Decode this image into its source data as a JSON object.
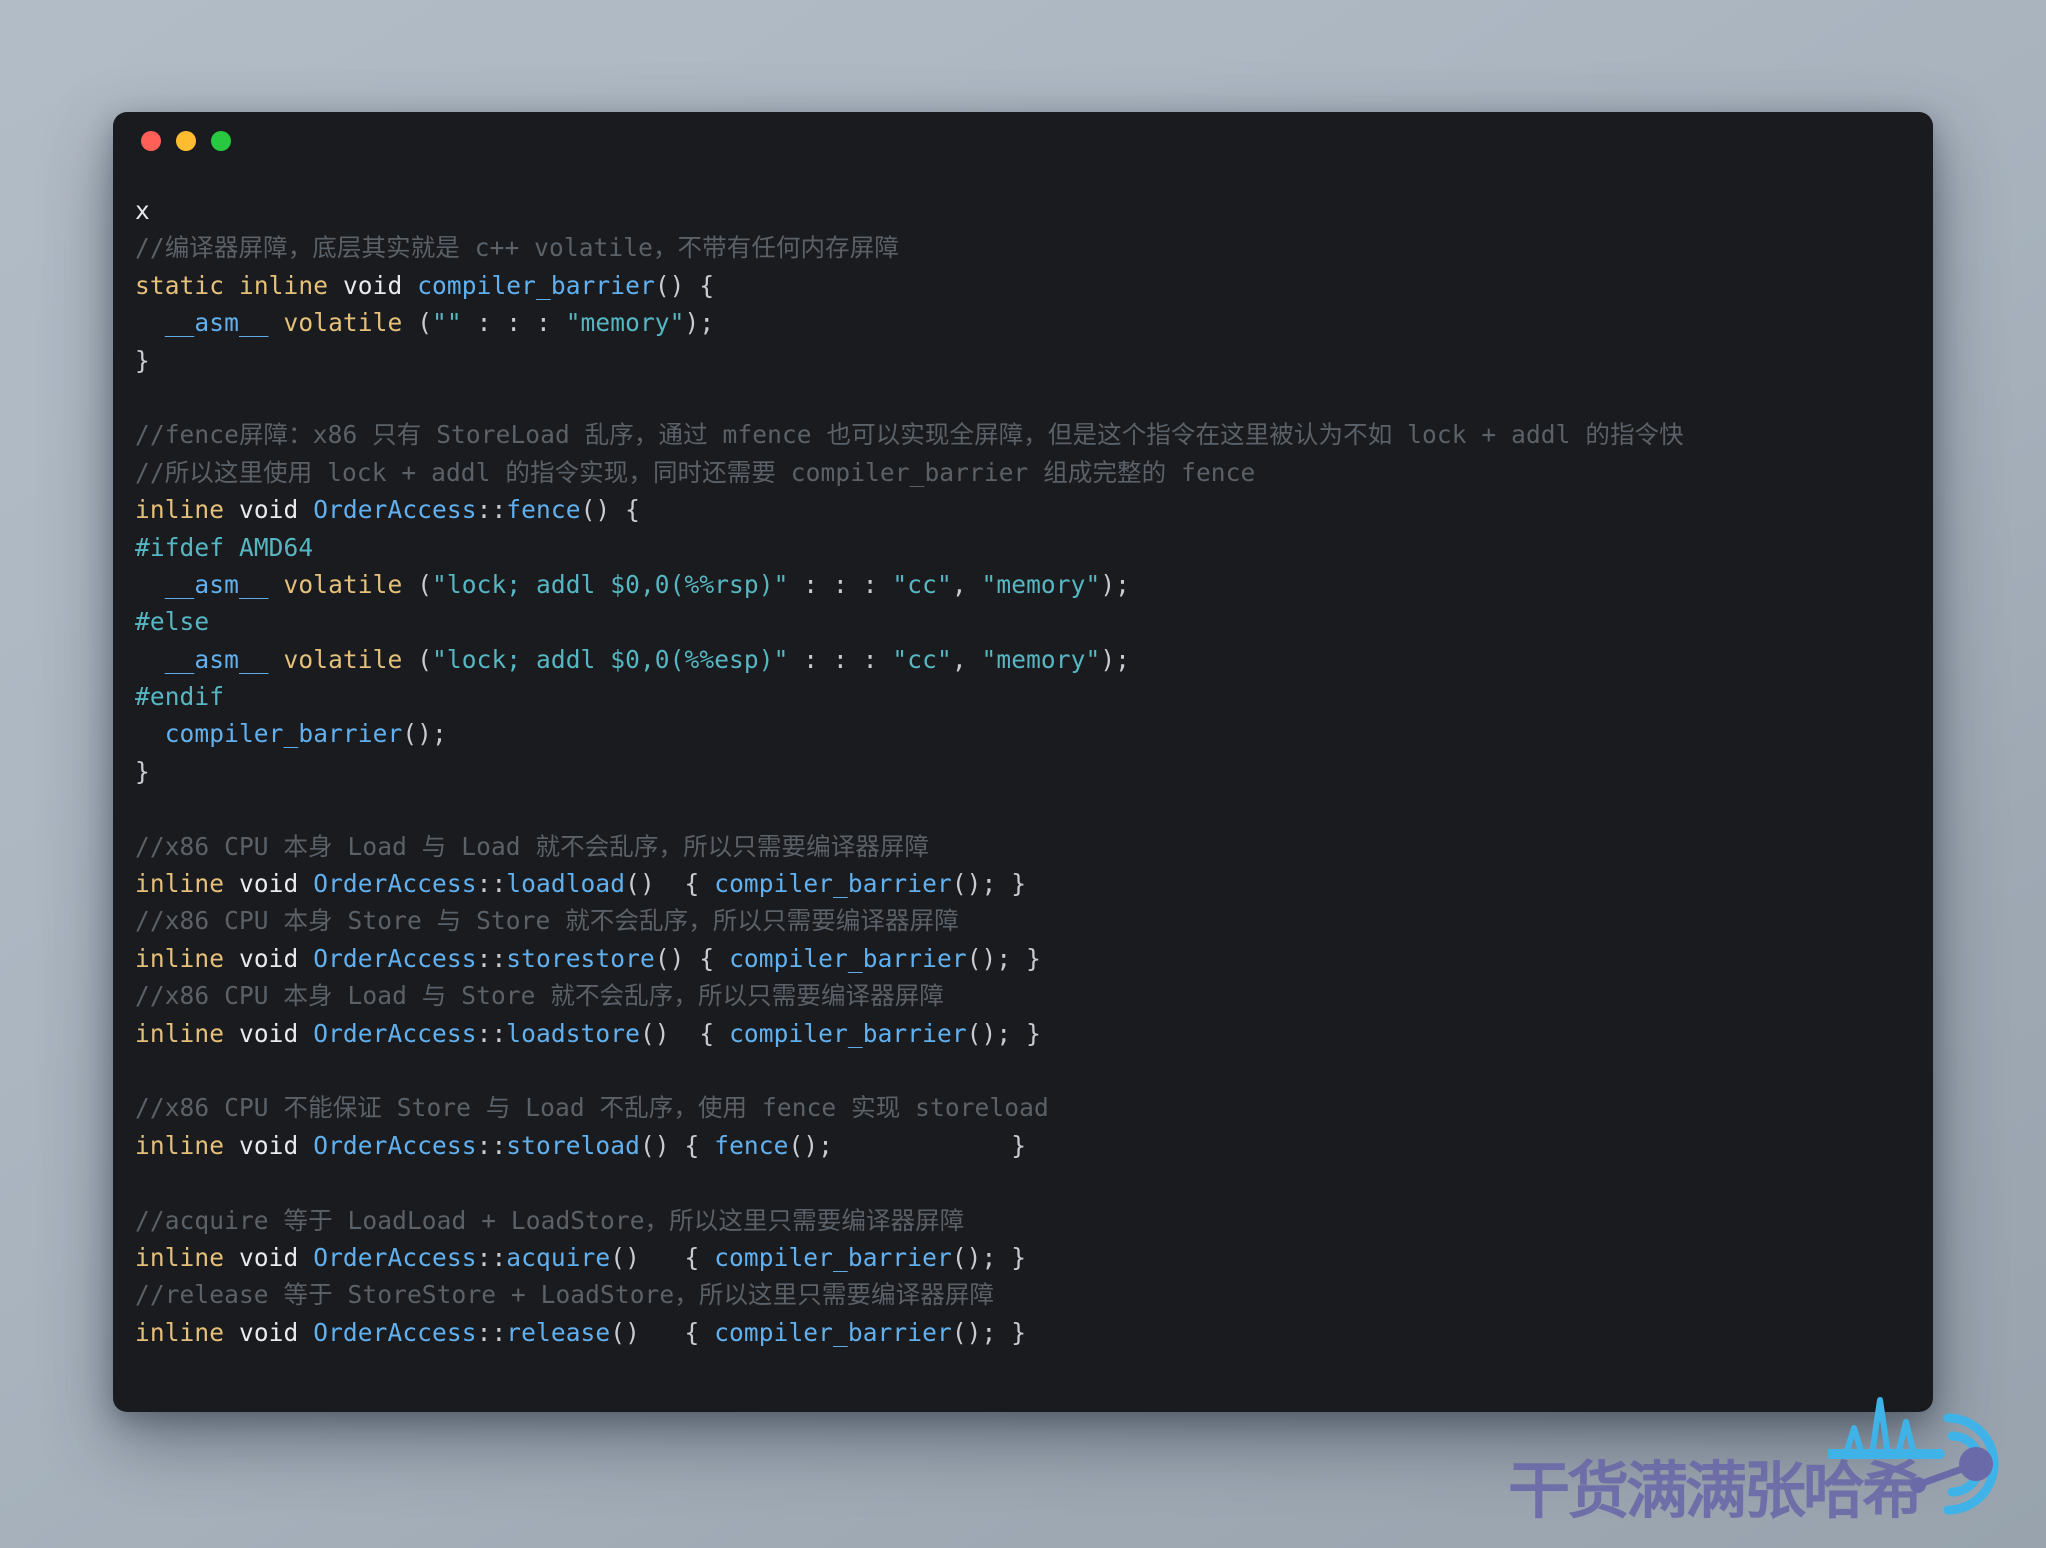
{
  "window": {
    "traffic_lights": [
      {
        "name": "close",
        "color": "#ff5f57"
      },
      {
        "name": "minimize",
        "color": "#febc2e"
      },
      {
        "name": "maximize",
        "color": "#28c840"
      }
    ]
  },
  "code": {
    "language": "cpp",
    "lines": [
      {
        "id": "l01",
        "tokens": [
          {
            "t": "x",
            "c": "pln"
          }
        ]
      },
      {
        "id": "l02",
        "tokens": [
          {
            "t": "//编译器屏障，底层其实就是 c++ volatile，不带有任何内存屏障",
            "c": "cmt"
          }
        ]
      },
      {
        "id": "l03",
        "tokens": [
          {
            "t": "static",
            "c": "kw"
          },
          {
            "t": " ",
            "c": "pln"
          },
          {
            "t": "inline",
            "c": "kw"
          },
          {
            "t": " ",
            "c": "pln"
          },
          {
            "t": "void",
            "c": "typ"
          },
          {
            "t": " ",
            "c": "pln"
          },
          {
            "t": "compiler_barrier",
            "c": "fn"
          },
          {
            "t": "() {",
            "c": "pun"
          }
        ]
      },
      {
        "id": "l04",
        "tokens": [
          {
            "t": "  ",
            "c": "pln"
          },
          {
            "t": "__asm__",
            "c": "fn"
          },
          {
            "t": " ",
            "c": "pln"
          },
          {
            "t": "volatile",
            "c": "kw"
          },
          {
            "t": " ",
            "c": "pln"
          },
          {
            "t": "(",
            "c": "pun"
          },
          {
            "t": "\"\"",
            "c": "str"
          },
          {
            "t": " : : : ",
            "c": "pun"
          },
          {
            "t": "\"memory\"",
            "c": "str"
          },
          {
            "t": ");",
            "c": "pun"
          }
        ]
      },
      {
        "id": "l05",
        "tokens": [
          {
            "t": "}",
            "c": "pun"
          }
        ]
      },
      {
        "id": "l06",
        "tokens": []
      },
      {
        "id": "l07",
        "tokens": [
          {
            "t": "//fence屏障：x86 只有 StoreLoad 乱序，通过 mfence 也可以实现全屏障，但是这个指令在这里被认为不如 lock + addl 的指令快",
            "c": "cmt"
          }
        ]
      },
      {
        "id": "l08",
        "tokens": [
          {
            "t": "//所以这里使用 lock + addl 的指令实现，同时还需要 compiler_barrier 组成完整的 fence",
            "c": "cmt"
          }
        ]
      },
      {
        "id": "l09",
        "tokens": [
          {
            "t": "inline",
            "c": "kw"
          },
          {
            "t": " ",
            "c": "pln"
          },
          {
            "t": "void",
            "c": "typ"
          },
          {
            "t": " ",
            "c": "pln"
          },
          {
            "t": "OrderAccess",
            "c": "ns"
          },
          {
            "t": "::",
            "c": "pun"
          },
          {
            "t": "fence",
            "c": "fn"
          },
          {
            "t": "() {",
            "c": "pun"
          }
        ]
      },
      {
        "id": "l10",
        "tokens": [
          {
            "t": "#ifdef",
            "c": "pp"
          },
          {
            "t": " ",
            "c": "pln"
          },
          {
            "t": "AMD64",
            "c": "pp"
          }
        ]
      },
      {
        "id": "l11",
        "tokens": [
          {
            "t": "  ",
            "c": "pln"
          },
          {
            "t": "__asm__",
            "c": "fn"
          },
          {
            "t": " ",
            "c": "pln"
          },
          {
            "t": "volatile",
            "c": "kw"
          },
          {
            "t": " ",
            "c": "pln"
          },
          {
            "t": "(",
            "c": "pun"
          },
          {
            "t": "\"lock; addl $0,0(%%rsp)\"",
            "c": "str"
          },
          {
            "t": " : : : ",
            "c": "pun"
          },
          {
            "t": "\"cc\"",
            "c": "str"
          },
          {
            "t": ", ",
            "c": "pun"
          },
          {
            "t": "\"memory\"",
            "c": "str"
          },
          {
            "t": ");",
            "c": "pun"
          }
        ]
      },
      {
        "id": "l12",
        "tokens": [
          {
            "t": "#else",
            "c": "pp"
          }
        ]
      },
      {
        "id": "l13",
        "tokens": [
          {
            "t": "  ",
            "c": "pln"
          },
          {
            "t": "__asm__",
            "c": "fn"
          },
          {
            "t": " ",
            "c": "pln"
          },
          {
            "t": "volatile",
            "c": "kw"
          },
          {
            "t": " ",
            "c": "pln"
          },
          {
            "t": "(",
            "c": "pun"
          },
          {
            "t": "\"lock; addl $0,0(%%esp)\"",
            "c": "str"
          },
          {
            "t": " : : : ",
            "c": "pun"
          },
          {
            "t": "\"cc\"",
            "c": "str"
          },
          {
            "t": ", ",
            "c": "pun"
          },
          {
            "t": "\"memory\"",
            "c": "str"
          },
          {
            "t": ");",
            "c": "pun"
          }
        ]
      },
      {
        "id": "l14",
        "tokens": [
          {
            "t": "#endif",
            "c": "pp"
          }
        ]
      },
      {
        "id": "l15",
        "tokens": [
          {
            "t": "  ",
            "c": "pln"
          },
          {
            "t": "compiler_barrier",
            "c": "fn"
          },
          {
            "t": "();",
            "c": "pun"
          }
        ]
      },
      {
        "id": "l16",
        "tokens": [
          {
            "t": "}",
            "c": "pun"
          }
        ]
      },
      {
        "id": "l17",
        "tokens": []
      },
      {
        "id": "l18",
        "tokens": [
          {
            "t": "//x86 CPU 本身 Load 与 Load 就不会乱序，所以只需要编译器屏障",
            "c": "cmt"
          }
        ]
      },
      {
        "id": "l19",
        "tokens": [
          {
            "t": "inline",
            "c": "kw"
          },
          {
            "t": " ",
            "c": "pln"
          },
          {
            "t": "void",
            "c": "typ"
          },
          {
            "t": " ",
            "c": "pln"
          },
          {
            "t": "OrderAccess",
            "c": "ns"
          },
          {
            "t": "::",
            "c": "pun"
          },
          {
            "t": "loadload",
            "c": "fn"
          },
          {
            "t": "()  { ",
            "c": "pun"
          },
          {
            "t": "compiler_barrier",
            "c": "fn"
          },
          {
            "t": "(); }",
            "c": "pun"
          }
        ]
      },
      {
        "id": "l20",
        "tokens": [
          {
            "t": "//x86 CPU 本身 Store 与 Store 就不会乱序，所以只需要编译器屏障",
            "c": "cmt"
          }
        ]
      },
      {
        "id": "l21",
        "tokens": [
          {
            "t": "inline",
            "c": "kw"
          },
          {
            "t": " ",
            "c": "pln"
          },
          {
            "t": "void",
            "c": "typ"
          },
          {
            "t": " ",
            "c": "pln"
          },
          {
            "t": "OrderAccess",
            "c": "ns"
          },
          {
            "t": "::",
            "c": "pun"
          },
          {
            "t": "storestore",
            "c": "fn"
          },
          {
            "t": "() { ",
            "c": "pun"
          },
          {
            "t": "compiler_barrier",
            "c": "fn"
          },
          {
            "t": "(); }",
            "c": "pun"
          }
        ]
      },
      {
        "id": "l22",
        "tokens": [
          {
            "t": "//x86 CPU 本身 Load 与 Store 就不会乱序，所以只需要编译器屏障",
            "c": "cmt"
          }
        ]
      },
      {
        "id": "l23",
        "tokens": [
          {
            "t": "inline",
            "c": "kw"
          },
          {
            "t": " ",
            "c": "pln"
          },
          {
            "t": "void",
            "c": "typ"
          },
          {
            "t": " ",
            "c": "pln"
          },
          {
            "t": "OrderAccess",
            "c": "ns"
          },
          {
            "t": "::",
            "c": "pun"
          },
          {
            "t": "loadstore",
            "c": "fn"
          },
          {
            "t": "()  { ",
            "c": "pun"
          },
          {
            "t": "compiler_barrier",
            "c": "fn"
          },
          {
            "t": "(); }",
            "c": "pun"
          }
        ]
      },
      {
        "id": "l24",
        "tokens": []
      },
      {
        "id": "l25",
        "tokens": [
          {
            "t": "//x86 CPU 不能保证 Store 与 Load 不乱序，使用 fence 实现 storeload",
            "c": "cmt"
          }
        ]
      },
      {
        "id": "l26",
        "tokens": [
          {
            "t": "inline",
            "c": "kw"
          },
          {
            "t": " ",
            "c": "pln"
          },
          {
            "t": "void",
            "c": "typ"
          },
          {
            "t": " ",
            "c": "pln"
          },
          {
            "t": "OrderAccess",
            "c": "ns"
          },
          {
            "t": "::",
            "c": "pun"
          },
          {
            "t": "storeload",
            "c": "fn"
          },
          {
            "t": "() { ",
            "c": "pun"
          },
          {
            "t": "fence",
            "c": "fn"
          },
          {
            "t": "();",
            "c": "pun"
          },
          {
            "t": "            }",
            "c": "pun"
          }
        ]
      },
      {
        "id": "l27",
        "tokens": []
      },
      {
        "id": "l28",
        "tokens": [
          {
            "t": "//acquire 等于 LoadLoad + LoadStore，所以这里只需要编译器屏障",
            "c": "cmt"
          }
        ]
      },
      {
        "id": "l29",
        "tokens": [
          {
            "t": "inline",
            "c": "kw"
          },
          {
            "t": " ",
            "c": "pln"
          },
          {
            "t": "void",
            "c": "typ"
          },
          {
            "t": " ",
            "c": "pln"
          },
          {
            "t": "OrderAccess",
            "c": "ns"
          },
          {
            "t": "::",
            "c": "pun"
          },
          {
            "t": "acquire",
            "c": "fn"
          },
          {
            "t": "()   { ",
            "c": "pun"
          },
          {
            "t": "compiler_barrier",
            "c": "fn"
          },
          {
            "t": "(); }",
            "c": "pun"
          }
        ]
      },
      {
        "id": "l30",
        "tokens": [
          {
            "t": "//release 等于 StoreStore + LoadStore，所以这里只需要编译器屏障",
            "c": "cmt"
          }
        ]
      },
      {
        "id": "l31",
        "tokens": [
          {
            "t": "inline",
            "c": "kw"
          },
          {
            "t": " ",
            "c": "pln"
          },
          {
            "t": "void",
            "c": "typ"
          },
          {
            "t": " ",
            "c": "pln"
          },
          {
            "t": "OrderAccess",
            "c": "ns"
          },
          {
            "t": "::",
            "c": "pun"
          },
          {
            "t": "release",
            "c": "fn"
          },
          {
            "t": "()   { ",
            "c": "pun"
          },
          {
            "t": "compiler_barrier",
            "c": "fn"
          },
          {
            "t": "(); }",
            "c": "pun"
          }
        ]
      }
    ]
  },
  "watermark": {
    "text": "干货满满张哈希",
    "text_color": "#6b6aa8",
    "logo_color": "#3fb3e8",
    "logo_dot_color": "#6b6aa8"
  }
}
